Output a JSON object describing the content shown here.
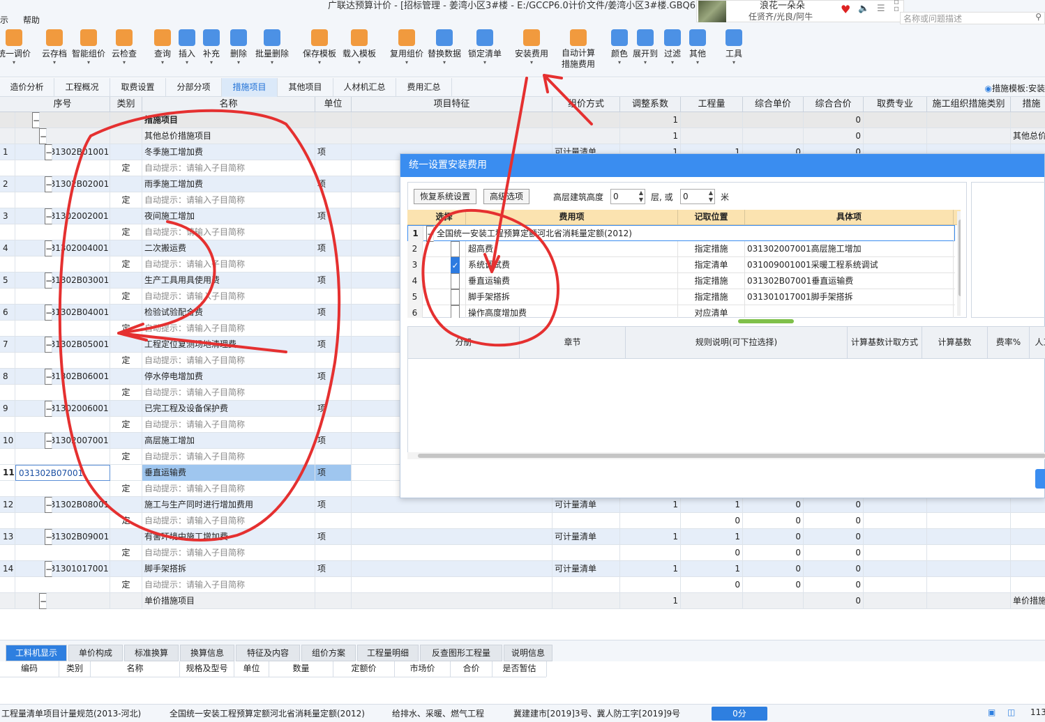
{
  "window": {
    "title": "广联达预算计价 - [招标管理 - 姜湾小区3#楼 - E:/GCCP6.0计价文件/姜湾小区3#楼.GBQ6]",
    "menu_left": "示",
    "menu_help": "帮助"
  },
  "music": {
    "song": "浪花一朵朵",
    "artist": "任贤齐/光良/阿牛"
  },
  "search": {
    "placeholder": "名称或问题描述"
  },
  "toolbar": [
    {
      "label": "统一调价",
      "icon": "unified-price-icon",
      "color": "#f08a1c"
    },
    {
      "label": "云存档",
      "icon": "cloud-archive-icon",
      "color": "#f08a1c"
    },
    {
      "label": "智能组价",
      "icon": "smart-price-icon",
      "color": "#f08a1c"
    },
    {
      "label": "云检查",
      "icon": "cloud-check-icon",
      "color": "#f08a1c"
    },
    {
      "label": "查询",
      "icon": "query-icon",
      "color": "#f08a1c"
    },
    {
      "label": "插入",
      "icon": "insert-icon",
      "color": "#2e7fe0"
    },
    {
      "label": "补充",
      "icon": "supplement-icon",
      "color": "#2e7fe0"
    },
    {
      "label": "删除",
      "icon": "delete-icon",
      "color": "#2e7fe0"
    },
    {
      "label": "批量删除",
      "icon": "batch-delete-icon",
      "color": "#2e7fe0"
    },
    {
      "label": "保存模板",
      "icon": "save-template-icon",
      "color": "#f08a1c"
    },
    {
      "label": "载入模板",
      "icon": "load-template-icon",
      "color": "#f08a1c"
    },
    {
      "label": "复用组价",
      "icon": "reuse-price-icon",
      "color": "#f08a1c"
    },
    {
      "label": "替换数据",
      "icon": "replace-data-icon",
      "color": "#2e7fe0"
    },
    {
      "label": "锁定清单",
      "icon": "lock-list-icon",
      "color": "#2e7fe0"
    },
    {
      "label": "安装费用",
      "icon": "install-fee-icon",
      "color": "#f08a1c"
    },
    {
      "label": "自动计算措施费用",
      "icon": "auto-calc-icon",
      "color": "#f08a1c"
    },
    {
      "label": "颜色",
      "icon": "color-icon",
      "color": "#2e7fe0"
    },
    {
      "label": "展开到",
      "icon": "expand-to-icon",
      "color": "#2e7fe0"
    },
    {
      "label": "过滤",
      "icon": "filter-icon",
      "color": "#2e7fe0"
    },
    {
      "label": "其他",
      "icon": "other-icon",
      "color": "#2e7fe0"
    },
    {
      "label": "工具",
      "icon": "tools-icon",
      "color": "#2e7fe0"
    }
  ],
  "tabs": [
    "造价分析",
    "工程概况",
    "取费设置",
    "分部分项",
    "措施项目",
    "其他项目",
    "人材机汇总",
    "费用汇总"
  ],
  "active_tab": "措施项目",
  "template_label": "措施模板:安装",
  "grid": {
    "headers": [
      "序号",
      "类别",
      "名称",
      "单位",
      "项目特征",
      "组价方式",
      "调整系数",
      "工程量",
      "综合单价",
      "综合合价",
      "取费专业",
      "施工组织措施类别",
      "措施"
    ],
    "rows": [
      {
        "type": "gray",
        "no": "",
        "code": "",
        "cat": "",
        "name": "措施项目",
        "unit": "",
        "feat": "",
        "method": "",
        "coef": "1",
        "qty": "",
        "up": "",
        "total": "0",
        "extra": ""
      },
      {
        "type": "sec",
        "no": "",
        "code": "1",
        "cat": "",
        "name": "其他总价措施项目",
        "unit": "",
        "feat": "",
        "method": "",
        "coef": "1",
        "qty": "",
        "up": "",
        "total": "0",
        "extra": "其他总价"
      },
      {
        "type": "item",
        "no": "1",
        "code": "031302B01001",
        "cat": "",
        "name": "冬季施工增加费",
        "unit": "项",
        "feat": "",
        "method": "可计量清单",
        "coef": "1",
        "qty": "1",
        "up": "0",
        "total": "0",
        "extra": ""
      },
      {
        "type": "sub",
        "no": "",
        "code": "",
        "cat": "定",
        "name": "自动提示：请输入子目简称",
        "unit": "",
        "feat": "",
        "method": "",
        "coef": "",
        "qty": "",
        "up": "",
        "total": "",
        "extra": ""
      },
      {
        "type": "item",
        "no": "2",
        "code": "031302B02001",
        "cat": "",
        "name": "雨季施工增加费",
        "unit": "项",
        "feat": "",
        "method": "",
        "coef": "",
        "qty": "",
        "up": "",
        "total": "",
        "extra": ""
      },
      {
        "type": "sub",
        "no": "",
        "code": "",
        "cat": "定",
        "name": "自动提示：请输入子目简称",
        "unit": "",
        "feat": "",
        "method": "",
        "coef": "",
        "qty": "",
        "up": "",
        "total": "",
        "extra": ""
      },
      {
        "type": "item",
        "no": "3",
        "code": "031302002001",
        "cat": "",
        "name": "夜间施工增加",
        "unit": "项",
        "feat": "",
        "method": "",
        "coef": "",
        "qty": "",
        "up": "",
        "total": "",
        "extra": ""
      },
      {
        "type": "sub",
        "no": "",
        "code": "",
        "cat": "定",
        "name": "自动提示：请输入子目简称",
        "unit": "",
        "feat": "",
        "method": "",
        "coef": "",
        "qty": "",
        "up": "",
        "total": "",
        "extra": ""
      },
      {
        "type": "item",
        "no": "4",
        "code": "031302004001",
        "cat": "",
        "name": "二次搬运费",
        "unit": "项",
        "feat": "",
        "method": "",
        "coef": "",
        "qty": "",
        "up": "",
        "total": "",
        "extra": ""
      },
      {
        "type": "sub",
        "no": "",
        "code": "",
        "cat": "定",
        "name": "自动提示：请输入子目简称",
        "unit": "",
        "feat": "",
        "method": "",
        "coef": "",
        "qty": "",
        "up": "",
        "total": "",
        "extra": ""
      },
      {
        "type": "item",
        "no": "5",
        "code": "031302B03001",
        "cat": "",
        "name": "生产工具用具使用费",
        "unit": "项",
        "feat": "",
        "method": "",
        "coef": "",
        "qty": "",
        "up": "",
        "total": "",
        "extra": ""
      },
      {
        "type": "sub",
        "no": "",
        "code": "",
        "cat": "定",
        "name": "自动提示：请输入子目简称",
        "unit": "",
        "feat": "",
        "method": "",
        "coef": "",
        "qty": "",
        "up": "",
        "total": "",
        "extra": ""
      },
      {
        "type": "item",
        "no": "6",
        "code": "031302B04001",
        "cat": "",
        "name": "检验试验配合费",
        "unit": "项",
        "feat": "",
        "method": "",
        "coef": "",
        "qty": "",
        "up": "",
        "total": "",
        "extra": ""
      },
      {
        "type": "sub",
        "no": "",
        "code": "",
        "cat": "定",
        "name": "自动提示：请输入子目简称",
        "unit": "",
        "feat": "",
        "method": "",
        "coef": "",
        "qty": "",
        "up": "",
        "total": "",
        "extra": ""
      },
      {
        "type": "item",
        "no": "7",
        "code": "031302B05001",
        "cat": "",
        "name": "工程定位复测场地清理费",
        "unit": "项",
        "feat": "",
        "method": "",
        "coef": "",
        "qty": "",
        "up": "",
        "total": "",
        "extra": ""
      },
      {
        "type": "sub",
        "no": "",
        "code": "",
        "cat": "定",
        "name": "自动提示：请输入子目简称",
        "unit": "",
        "feat": "",
        "method": "",
        "coef": "",
        "qty": "",
        "up": "",
        "total": "",
        "extra": ""
      },
      {
        "type": "item",
        "no": "8",
        "code": "031302B06001",
        "cat": "",
        "name": "停水停电增加费",
        "unit": "项",
        "feat": "",
        "method": "",
        "coef": "",
        "qty": "",
        "up": "",
        "total": "",
        "extra": ""
      },
      {
        "type": "sub",
        "no": "",
        "code": "",
        "cat": "定",
        "name": "自动提示：请输入子目简称",
        "unit": "",
        "feat": "",
        "method": "",
        "coef": "",
        "qty": "",
        "up": "",
        "total": "",
        "extra": ""
      },
      {
        "type": "item",
        "no": "9",
        "code": "031302006001",
        "cat": "",
        "name": "已完工程及设备保护费",
        "unit": "项",
        "feat": "",
        "method": "",
        "coef": "",
        "qty": "",
        "up": "",
        "total": "",
        "extra": ""
      },
      {
        "type": "sub",
        "no": "",
        "code": "",
        "cat": "定",
        "name": "自动提示：请输入子目简称",
        "unit": "",
        "feat": "",
        "method": "",
        "coef": "",
        "qty": "",
        "up": "",
        "total": "",
        "extra": ""
      },
      {
        "type": "item",
        "no": "10",
        "code": "031302007001",
        "cat": "",
        "name": "高层施工增加",
        "unit": "项",
        "feat": "",
        "method": "",
        "coef": "",
        "qty": "",
        "up": "",
        "total": "",
        "extra": ""
      },
      {
        "type": "sub",
        "no": "",
        "code": "",
        "cat": "定",
        "name": "自动提示：请输入子目简称",
        "unit": "",
        "feat": "",
        "method": "",
        "coef": "",
        "qty": "",
        "up": "",
        "total": "",
        "extra": ""
      },
      {
        "type": "sel",
        "no": "11",
        "code": "031302B07001",
        "cat": "",
        "name": "垂直运输费",
        "unit": "项",
        "feat": "",
        "method": "",
        "coef": "",
        "qty": "",
        "up": "",
        "total": "",
        "extra": ""
      },
      {
        "type": "sub",
        "no": "",
        "code": "",
        "cat": "定",
        "name": "自动提示：请输入子目简称",
        "unit": "",
        "feat": "",
        "method": "",
        "coef": "",
        "qty": "",
        "up": "",
        "total": "",
        "extra": ""
      },
      {
        "type": "item",
        "no": "12",
        "code": "031302B08001",
        "cat": "",
        "name": "施工与生产同时进行增加费用",
        "unit": "项",
        "feat": "",
        "method": "可计量清单",
        "coef": "1",
        "qty": "1",
        "up": "0",
        "total": "0",
        "extra": ""
      },
      {
        "type": "sub",
        "no": "",
        "code": "",
        "cat": "定",
        "name": "自动提示：请输入子目简称",
        "unit": "",
        "feat": "",
        "method": "",
        "coef": "",
        "qty": "0",
        "up": "0",
        "total": "0",
        "extra": ""
      },
      {
        "type": "item",
        "no": "13",
        "code": "031302B09001",
        "cat": "",
        "name": "有害环境中施工增加费",
        "unit": "项",
        "feat": "",
        "method": "可计量清单",
        "coef": "1",
        "qty": "1",
        "up": "0",
        "total": "0",
        "extra": ""
      },
      {
        "type": "sub",
        "no": "",
        "code": "",
        "cat": "定",
        "name": "自动提示：请输入子目简称",
        "unit": "",
        "feat": "",
        "method": "",
        "coef": "",
        "qty": "0",
        "up": "0",
        "total": "0",
        "extra": ""
      },
      {
        "type": "item",
        "no": "14",
        "code": "031301017001",
        "cat": "",
        "name": "脚手架搭拆",
        "unit": "项",
        "feat": "",
        "method": "可计量清单",
        "coef": "1",
        "qty": "1",
        "up": "0",
        "total": "0",
        "extra": ""
      },
      {
        "type": "sub",
        "no": "",
        "code": "",
        "cat": "定",
        "name": "自动提示：请输入子目简称",
        "unit": "",
        "feat": "",
        "method": "",
        "coef": "",
        "qty": "0",
        "up": "0",
        "total": "0",
        "extra": ""
      },
      {
        "type": "sec",
        "no": "",
        "code": "2",
        "cat": "",
        "name": "单价措施项目",
        "unit": "",
        "feat": "",
        "method": "",
        "coef": "1",
        "qty": "",
        "up": "",
        "total": "0",
        "extra": "单价措施"
      }
    ]
  },
  "dialog": {
    "title": "统一设置安装费用",
    "restore_btn": "恢复系统设置",
    "advanced_btn": "高级选项",
    "height_label": "高层建筑高度",
    "height_value": "0",
    "floors_label": "层, 或",
    "floors_value": "0",
    "meter_label": "米",
    "fee_headers": [
      "选择",
      "费用项",
      "记取位置",
      "具体项"
    ],
    "fee_rows": [
      {
        "no": "1",
        "checked": null,
        "name": "全国统一安装工程预算定额河北省消耗量定额(2012)",
        "pos": "",
        "detail": ""
      },
      {
        "no": "2",
        "checked": false,
        "name": "超高费",
        "pos": "指定措施",
        "detail": "031302007001高层施工增加"
      },
      {
        "no": "3",
        "checked": true,
        "name": "系统调试费",
        "pos": "指定清单",
        "detail": "031009001001采暖工程系统调试"
      },
      {
        "no": "4",
        "checked": false,
        "name": "垂直运输费",
        "pos": "指定措施",
        "detail": "031302B07001垂直运输费"
      },
      {
        "no": "5",
        "checked": false,
        "name": "脚手架搭拆",
        "pos": "指定措施",
        "detail": "031301017001脚手架搭拆"
      },
      {
        "no": "6",
        "checked": false,
        "name": "操作高度增加费",
        "pos": "对应清单",
        "detail": ""
      }
    ],
    "rule_headers": [
      "分册",
      "章节",
      "规则说明(可下拉选择)",
      "计算基数计取方式",
      "计算基数",
      "费率%",
      "人工"
    ]
  },
  "bottom_tabs": [
    "工料机显示",
    "单价构成",
    "标准换算",
    "换算信息",
    "特征及内容",
    "组价方案",
    "工程量明细",
    "反查图形工程量",
    "说明信息"
  ],
  "bottom_headers": [
    "编码",
    "类别",
    "名称",
    "规格及型号",
    "单位",
    "数量",
    "定额价",
    "市场价",
    "合价",
    "是否暂估"
  ],
  "status": {
    "s1": "工程量清单项目计量规范(2013-河北)",
    "s2": "全国统一安装工程预算定额河北省消耗量定额(2012)",
    "s3": "给排水、采暖、燃气工程",
    "s4": "冀建建市[2019]3号、冀人防工字[2019]9号",
    "score": "0分",
    "zoom": "113"
  },
  "colors": {
    "accent": "#2e7fe0",
    "annotation": "#e53030",
    "dialog_header": "#3a8df0"
  }
}
